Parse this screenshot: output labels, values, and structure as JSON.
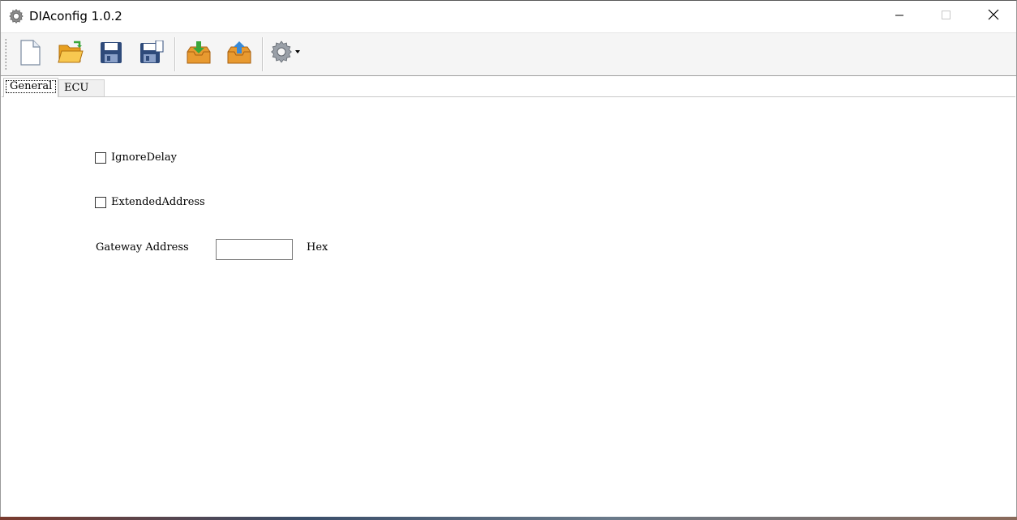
{
  "window": {
    "title": "DIAconfig 1.0.2",
    "icons": {
      "app": "gear-icon",
      "minimize": "minimize-icon",
      "maximize": "maximize-icon",
      "close": "close-icon"
    }
  },
  "toolbar": {
    "buttons": [
      {
        "name": "new-file-button",
        "icon": "new-document-icon"
      },
      {
        "name": "open-file-button",
        "icon": "open-folder-icon"
      },
      {
        "name": "save-button",
        "icon": "floppy-disk-icon"
      },
      {
        "name": "save-as-button",
        "icon": "floppy-disk-pen-icon"
      },
      {
        "name": "import-button",
        "icon": "inbox-download-icon"
      },
      {
        "name": "export-button",
        "icon": "inbox-upload-icon"
      },
      {
        "name": "settings-dropdown-button",
        "icon": "gear-dropdown-icon"
      }
    ]
  },
  "tabs": [
    {
      "label": "General",
      "active": true
    },
    {
      "label": "ECU",
      "active": false
    }
  ],
  "general": {
    "ignore_delay": {
      "label": "IgnoreDelay",
      "checked": false
    },
    "extended_address": {
      "label": "ExtendedAddress",
      "checked": false
    },
    "gateway_address": {
      "label": "Gateway Address",
      "value": "",
      "unit": "Hex"
    }
  },
  "colors": {
    "folder": "#f0b030",
    "disk": "#2e4a7a",
    "green_arrow": "#3aa63a",
    "blue_arrow": "#3a8ad6",
    "tray": "#e89a30"
  }
}
